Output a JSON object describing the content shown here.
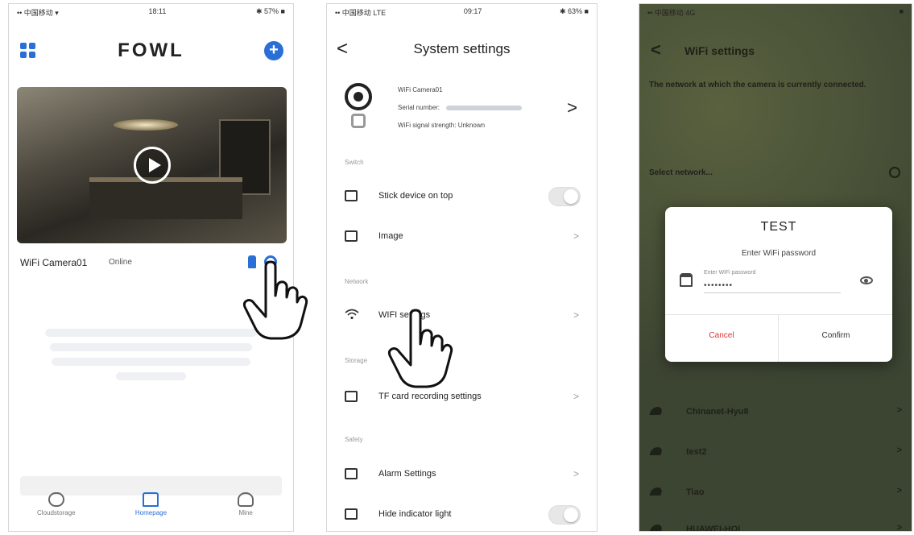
{
  "phone1": {
    "status": {
      "carrier": "•• 中国移动 ▾",
      "time": "18:11",
      "battery": "✱ 57% ■"
    },
    "logo": "FOWL",
    "camera": {
      "name": "WiFi Camera01",
      "status": "Online"
    },
    "tabs": [
      {
        "label": "Cloudstorage"
      },
      {
        "label": "Homepage"
      },
      {
        "label": "Mine"
      }
    ]
  },
  "phone2": {
    "status": {
      "carrier": "•• 中国移动 LTE",
      "time": "09:17",
      "battery": "✱ 63% ■"
    },
    "back": "<",
    "title": "System settings",
    "device": {
      "name": "WiFi Camera01",
      "serial_label": "Serial number:",
      "signal": "WiFi signal strength: Unknown",
      "chevron": ">"
    },
    "sections": {
      "switch": "Switch",
      "network": "Network",
      "storage": "Storage",
      "safety": "Safety"
    },
    "rows": {
      "stick": "Stick device on top",
      "image": "Image",
      "wifi": "WIFI settings",
      "tf": "TF card recording settings",
      "alarm": "Alarm Settings",
      "indicator": "Hide indicator light"
    },
    "chevron": ">"
  },
  "phone3": {
    "status": {
      "carrier": "•• 中国移动 4G",
      "time": "",
      "battery": "■"
    },
    "back": "<",
    "title": "WiFi settings",
    "description": "The network at which the camera is currently connected.",
    "select_label": "Select network...",
    "networks": [
      {
        "name": "Chinanet-Hyu8"
      },
      {
        "name": "test2"
      },
      {
        "name": "Tiao"
      },
      {
        "name": "HUAWEI-HOI"
      }
    ],
    "chevron": ">",
    "dialog": {
      "title": "TEST",
      "subtitle": "Enter WiFi password",
      "placeholder": "Enter WiFi password",
      "value": "••••••••",
      "cancel": "Cancel",
      "confirm": "Confirm"
    }
  },
  "colors": {
    "accent": "#2a6fd6",
    "cancel": "#dd3333"
  }
}
